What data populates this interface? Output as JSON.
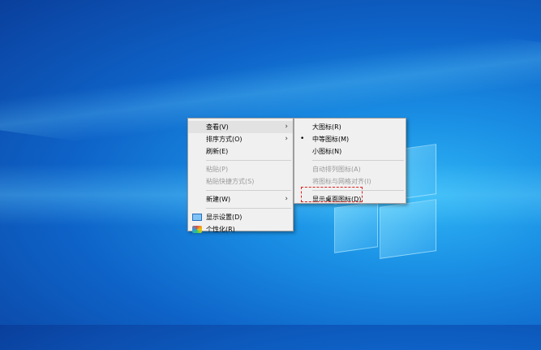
{
  "context_menu": {
    "items": [
      {
        "label": "查看(V)",
        "has_submenu": true,
        "highlighted": true
      },
      {
        "label": "排序方式(O)",
        "has_submenu": true
      },
      {
        "label": "刷新(E)"
      },
      {
        "label": "粘贴(P)",
        "disabled": true
      },
      {
        "label": "粘贴快捷方式(S)",
        "disabled": true
      },
      {
        "label": "新建(W)",
        "has_submenu": true
      },
      {
        "label": "显示设置(D)",
        "icon": "display-settings-icon"
      },
      {
        "label": "个性化(R)",
        "icon": "personalize-icon"
      }
    ]
  },
  "view_submenu": {
    "items": [
      {
        "label": "大图标(R)"
      },
      {
        "label": "中等图标(M)",
        "selected": true
      },
      {
        "label": "小图标(N)"
      },
      {
        "label": "自动排列图标(A)",
        "disabled": true
      },
      {
        "label": "将图标与网格对齐(I)",
        "disabled": true
      },
      {
        "label": "显示桌面图标(D)",
        "highlighted_callout": true
      }
    ]
  },
  "glyphs": {
    "submenu_arrow": "›",
    "bullet": "•"
  },
  "colors": {
    "callout": "#e0201c",
    "menu_bg": "#f0f0f0"
  }
}
